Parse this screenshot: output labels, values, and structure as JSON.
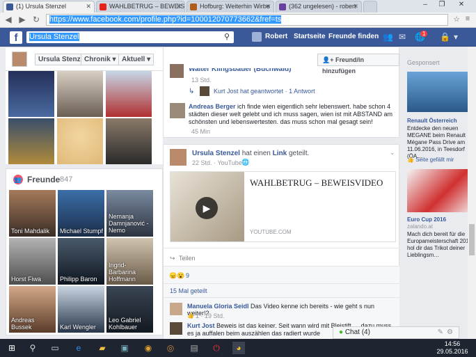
{
  "browser": {
    "tabs": [
      {
        "label": "(1) Ursula Stenzel",
        "active": true,
        "color": "#3b5998"
      },
      {
        "label": "WAHLBETRUG – BEWEIS",
        "active": false,
        "color": "#e62117"
      },
      {
        "label": "Hofburg: Weiterhin Wirbe",
        "active": false,
        "color": "#b05c1a"
      },
      {
        "label": "(362 ungelesen) - robert",
        "active": false,
        "color": "#6b3fa0"
      }
    ],
    "window_controls": [
      "–",
      "❐",
      "✕"
    ],
    "url_selected": "https://www.facebook.com/profile.php?id=100012070773662&fref=ts",
    "nav": [
      "◀",
      "▶",
      "↻"
    ]
  },
  "fb_header": {
    "logo": "f",
    "search_value": "Ursula Stenzel",
    "user": "Robert",
    "home": "Startseite",
    "find_friends": "Freunde finden",
    "notif_count": "1"
  },
  "profile_bar": {
    "name": "Ursula Stenzel",
    "chronik": "Chronik ▾",
    "aktuell": "Aktuell ▾"
  },
  "friends": {
    "title": "Freunde",
    "count": "847",
    "list": [
      "Toni Mahdalik",
      "Michael Stumpf",
      "Nemanja Damnjanović - Nemo",
      "Horst Fiwa",
      "Philipp Baron",
      "Ingrid-Barbarina Hoffmann",
      "Andreas Bussek",
      "Karl Wengler",
      "Leo Gabriel Kohlbauer"
    ]
  },
  "center": {
    "partial_name": "Walter Klingsbauer (Buchwald)",
    "partial_time": "13 Std.",
    "reply_author": "Kurt Jost",
    "reply_text": "hat geantwortet",
    "reply_count": "· 1 Antwort",
    "comment_author": "Andreas Berger",
    "comment_text": "ich finde wien eigentlich sehr lebenswert. habe schon 4 städten dieser welt gelebt und ich muss sagen, wien ist mit ABSTAND am schönsten und lebenswertesten. das muss schon mal gesagt sein!",
    "comment_time": "45 Min",
    "add_friend": "Freund/in hinzufügen",
    "post": {
      "author": "Ursula Stenzel",
      "action": "hat einen",
      "link_word": "Link",
      "action2": "geteilt.",
      "time": "22 Std. · YouTube ·",
      "video_title": "WAHLBETRUG – BEWEISVIDEO",
      "video_source": "YOUTUBE.COM",
      "share": "Teilen",
      "reactions": "9",
      "shares": "15 Mal geteilt"
    },
    "c1_author": "Manuela Gloria Seidl",
    "c1_text": "Das Video kenne ich bereits - wie geht s nun weiter!?",
    "c1_meta": "1 · 19 Std.",
    "c2_author": "Kurt Jost",
    "c2_text": "Beweis ist das keiner. Seit wann wird mit Bleistift … dazu muss es ja auffalen beim auszählen das radiert wurde"
  },
  "right": {
    "sponsored": "Gesponsert",
    "ad1_title": "Renault Österreich",
    "ad1_text": "Entdecke den neuen MEGANE beim Renault Mégane Pass Drive am 11.06.2016, in Teesdorf (ÖA…",
    "ad1_like": "Seite gefällt mir",
    "ad2_title": "Euro Cup 2016",
    "ad2_source": "zalando.at",
    "ad2_text": "Mach dich bereit für die Europameisterschaft 2016 hol dir das Trikot deiner Lieblingsm…"
  },
  "chat": {
    "label": "Chat (4)"
  },
  "taskbar": {
    "time": "14:56",
    "date": "29.05.2016"
  }
}
